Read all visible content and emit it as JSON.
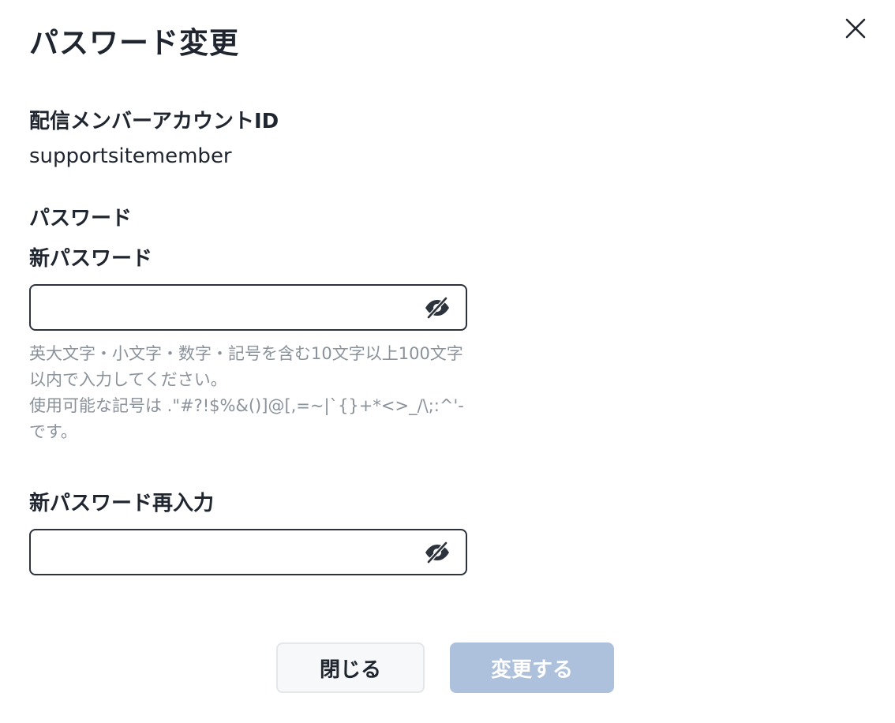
{
  "dialog": {
    "title": "パスワード変更",
    "close_icon": "close-icon"
  },
  "account": {
    "label": "配信メンバーアカウントID",
    "value": "supportsitemember"
  },
  "password": {
    "section_label": "パスワード",
    "new_label": "新パスワード",
    "new_value": "",
    "hint_line1": "英大文字・小文字・数字・記号を含む10文字以上100文字以内で入力してください。",
    "hint_line2": "使用可能な記号は .\"#?!$%&()]@[,=~|`{}+*<>_/\\;:^'- です。",
    "confirm_label": "新パスワード再入力",
    "confirm_value": "",
    "toggle_icon": "eye-slash-icon"
  },
  "footer": {
    "close_label": "閉じる",
    "submit_label": "変更する"
  },
  "colors": {
    "text": "#1f2630",
    "hint": "#8a929b",
    "border": "#2c333c",
    "submit_disabled_bg": "#aec1dc",
    "close_bg": "#f7f8fa"
  }
}
